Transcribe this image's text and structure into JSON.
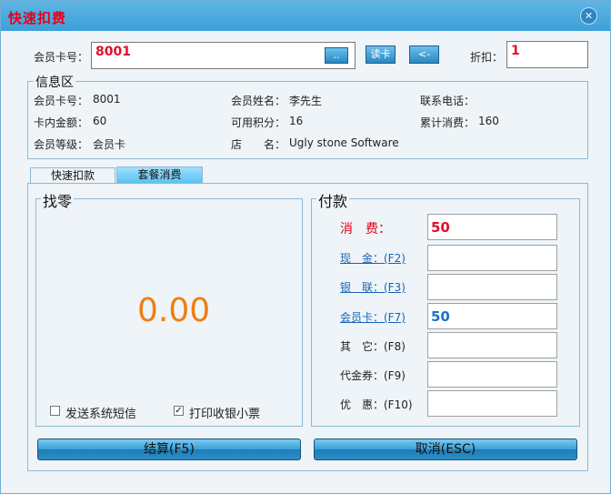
{
  "window": {
    "title": "快速扣费",
    "close_icon": "close-icon"
  },
  "top": {
    "card_label": "会员卡号：",
    "card_value": "8001",
    "browse_btn": "..",
    "read_btn": "读卡",
    "back_btn": "<-",
    "discount_label": "折扣：",
    "discount_value": "1"
  },
  "info": {
    "title": "信息区",
    "card_no_label": "会员卡号：",
    "card_no": "8001",
    "name_label": "会员姓名：",
    "name": "李先生",
    "phone_label": "联系电话：",
    "phone": "",
    "balance_label": "卡内金额：",
    "balance": "60",
    "points_label": "可用积分：",
    "points": "16",
    "total_label": "累计消费：",
    "total": "160",
    "level_label": "会员等级：",
    "level": "会员卡",
    "store_label": "店　　名：",
    "store": "Ugly stone Software"
  },
  "tabs": [
    {
      "label": "快速扣款",
      "active": false
    },
    {
      "label": "套餐消费",
      "active": true
    }
  ],
  "change": {
    "title": "找零",
    "amount": "0.00",
    "sms_label": "发送系统短信",
    "sms_checked": false,
    "print_label": "打印收银小票",
    "print_checked": true
  },
  "payment": {
    "title": "付款",
    "rows": [
      {
        "label": "消　费：",
        "value": "50",
        "style": "red"
      },
      {
        "label": "现　金：(F2)",
        "value": "",
        "style": "link"
      },
      {
        "label": "银　联：(F3)",
        "value": "",
        "style": "link"
      },
      {
        "label": "会员卡：(F7)",
        "value": "50",
        "style": "link"
      },
      {
        "label": "其　它：(F8)",
        "value": "",
        "style": "plain"
      },
      {
        "label": "代金券：(F9)",
        "value": "",
        "style": "plain"
      },
      {
        "label": "优　惠：(F10)",
        "value": "",
        "style": "plain"
      }
    ]
  },
  "buttons": {
    "settle": "结算(F5)",
    "cancel": "取消(ESC)"
  },
  "colors": {
    "title_red": "#e6001a",
    "change_orange": "#f07d12",
    "member_blue": "#1a73c9",
    "accent": "#3ea0d9"
  }
}
